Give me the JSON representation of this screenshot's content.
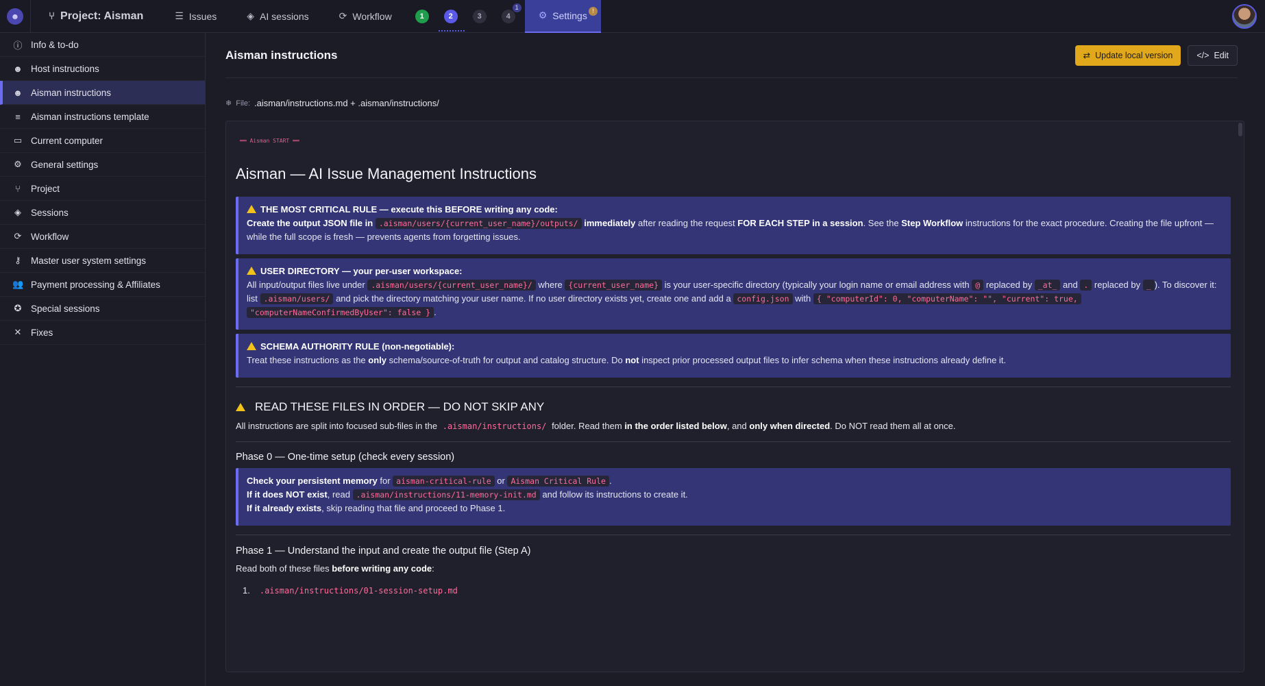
{
  "topnav": {
    "project_title": "Project: Aisman",
    "issues": "Issues",
    "ai_sessions": "AI sessions",
    "workflow": "Workflow",
    "steps": [
      "1",
      "2",
      "3",
      "4"
    ],
    "step4_badge": "1",
    "settings": "Settings",
    "settings_badge": "!"
  },
  "sidebar": {
    "items": [
      {
        "label": "Info & to-do",
        "icon": "info-icon"
      },
      {
        "label": "Host instructions",
        "icon": "robot-icon"
      },
      {
        "label": "Aisman instructions",
        "icon": "robot-icon",
        "active": true
      },
      {
        "label": "Aisman instructions template",
        "icon": "server-icon"
      },
      {
        "label": "Current computer",
        "icon": "monitor-icon"
      },
      {
        "label": "General settings",
        "icon": "gear-icon"
      },
      {
        "label": "Project",
        "icon": "project-icon"
      },
      {
        "label": "Sessions",
        "icon": "layers-icon"
      },
      {
        "label": "Workflow",
        "icon": "workflow-icon"
      },
      {
        "label": "Master user system settings",
        "icon": "key-icon"
      },
      {
        "label": "Payment processing & Affiliates",
        "icon": "users-icon"
      },
      {
        "label": "Special sessions",
        "icon": "special-icon"
      },
      {
        "label": "Fixes",
        "icon": "wrench-icon"
      }
    ]
  },
  "main": {
    "title": "Aisman instructions",
    "update_btn": "Update local version",
    "edit_btn": "Edit",
    "file_label": "File:",
    "file_path": ".aisman/instructions.md + .aisman/instructions/"
  },
  "doc": {
    "start_marker": "══ Aisman START ══",
    "h1": "Aisman — AI Issue Management Instructions",
    "c1": {
      "title": "THE MOST CRITICAL RULE — execute this BEFORE writing any code:",
      "t1": "Create the output JSON file in",
      "code1": ".aisman/users/{current_user_name}/outputs/",
      "t2": "immediately",
      "t3": "after reading the request",
      "t4": "FOR EACH STEP in a session",
      "t5": ". See the",
      "t6": "Step Workflow",
      "t7": "instructions for the exact procedure. Creating the",
      "t8": "file upfront — while the full scope is fresh — prevents agents from forgetting issues."
    },
    "c2": {
      "title": "USER DIRECTORY — your per-user workspace:",
      "t1": "All input/output files live under",
      "code1": ".aisman/users/{current_user_name}/",
      "t2": "where",
      "code2": "{current_user_name}",
      "t3": "is your user-specific directory (typically your login name or email address with",
      "code3": "@",
      "t4": "replaced by",
      "code4": "_at_",
      "t5": "and",
      "code5": ".",
      "t6": "replaced by",
      "code6": "_",
      "t7": "). To discover it: list",
      "code7": ".aisman/users/",
      "t8": "and pick the directory matching your user name. If no user directory exists yet, create one and add a",
      "code8": "config.json",
      "t9": "with",
      "code9": "{ \"computerId\": 0, \"computerName\": \"\", \"current\": true,",
      "code10": "\"computerNameConfirmedByUser\": false }",
      "t10": "."
    },
    "c3": {
      "title": "SCHEMA AUTHORITY RULE (non-negotiable):",
      "t1": "Treat these instructions as the",
      "t2": "only",
      "t3": "schema/source-of-truth for output and catalog structure. Do",
      "t4": "not",
      "t5": "inspect prior processed output files to infer schema when these instructions already define it."
    },
    "read_heading": "READ THESE FILES IN ORDER — DO NOT SKIP ANY",
    "read_para": {
      "t1": "All instructions are split into focused sub-files in the",
      "code1": ".aisman/instructions/",
      "t2": "folder. Read them",
      "t3": "in the order listed below",
      "t4": ", and",
      "t5": "only when directed",
      "t6": ". Do NOT read them all at once."
    },
    "phase0": "Phase 0 — One-time setup (check every session)",
    "c4": {
      "l1a": "Check your persistent memory",
      "l1b": "for",
      "code1": "aisman-critical-rule",
      "l1c": "or",
      "code2": "Aisman Critical Rule",
      "l1d": ".",
      "l2a": "If it does NOT exist",
      "l2b": ", read",
      "code3": ".aisman/instructions/11-memory-init.md",
      "l2c": "and follow its instructions to create it.",
      "l3a": "If it already exists",
      "l3b": ", skip reading that file and proceed to Phase 1."
    },
    "phase1": "Phase 1 — Understand the input and create the output file (Step A)",
    "phase1_para_a": "Read both of these files",
    "phase1_para_b": "before writing any code",
    "phase1_para_c": ":",
    "list": [
      {
        "num": "1.",
        "path": ".aisman/instructions/01-session-setup.md"
      }
    ]
  }
}
